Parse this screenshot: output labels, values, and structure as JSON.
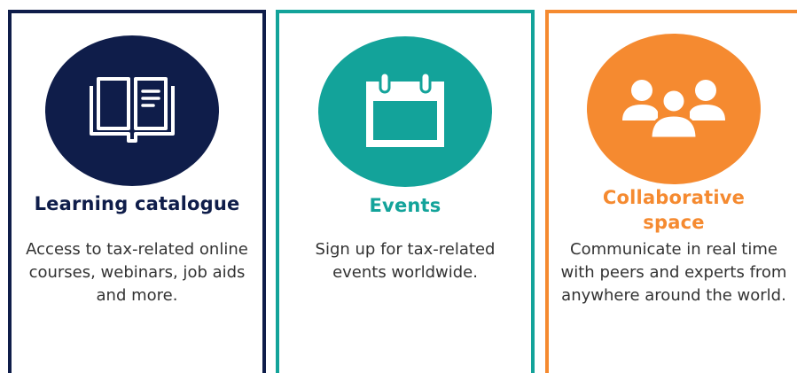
{
  "colors": {
    "navy": "#0f1d4a",
    "teal": "#13a39a",
    "orange": "#f58a30",
    "text": "#333333"
  },
  "cards": [
    {
      "title": "Learning catalogue",
      "description": "Access to tax-related online courses, webinars, job aids and more.",
      "icon": "open-book-icon",
      "color": "#0f1d4a"
    },
    {
      "title": "Events",
      "description": "Sign up for tax-related events worldwide.",
      "icon": "calendar-icon",
      "color": "#13a39a"
    },
    {
      "title": "Collaborative space",
      "description": "Communicate in real time with peers and experts from anywhere around the world.",
      "icon": "people-group-icon",
      "color": "#f58a30"
    }
  ]
}
